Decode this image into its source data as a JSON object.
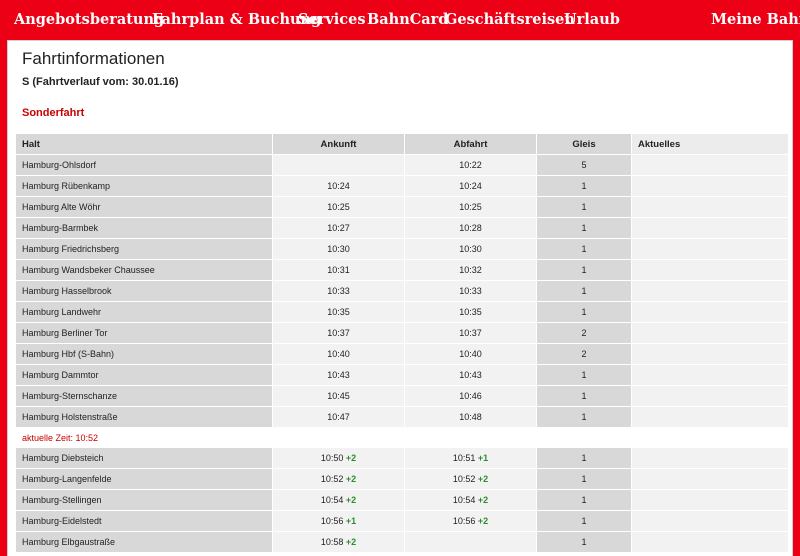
{
  "nav": {
    "items": [
      "Angebotsberatung",
      "Fahrplan & Buchung",
      "Services",
      "BahnCard",
      "Geschäftsreisen",
      "Urlaub"
    ],
    "meine_bahn": "Meine Bahn"
  },
  "page": {
    "title": "Fahrtinformationen",
    "subtitle": "S (Fahrtverlauf vom: 30.01.16)",
    "special": "Sonderfahrt"
  },
  "table": {
    "headers": {
      "halt": "Halt",
      "ankunft": "Ankunft",
      "abfahrt": "Abfahrt",
      "gleis": "Gleis",
      "aktuelles": "Aktuelles"
    },
    "rows_before": [
      {
        "halt": "Hamburg-Ohlsdorf",
        "ankunft": "",
        "abfahrt": "10:22",
        "gleis": "5"
      },
      {
        "halt": "Hamburg Rübenkamp",
        "ankunft": "10:24",
        "abfahrt": "10:24",
        "gleis": "1"
      },
      {
        "halt": "Hamburg Alte Wöhr",
        "ankunft": "10:25",
        "abfahrt": "10:25",
        "gleis": "1"
      },
      {
        "halt": "Hamburg-Barmbek",
        "ankunft": "10:27",
        "abfahrt": "10:28",
        "gleis": "1"
      },
      {
        "halt": "Hamburg Friedrichsberg",
        "ankunft": "10:30",
        "abfahrt": "10:30",
        "gleis": "1"
      },
      {
        "halt": "Hamburg Wandsbeker Chaussee",
        "ankunft": "10:31",
        "abfahrt": "10:32",
        "gleis": "1"
      },
      {
        "halt": "Hamburg Hasselbrook",
        "ankunft": "10:33",
        "abfahrt": "10:33",
        "gleis": "1"
      },
      {
        "halt": "Hamburg Landwehr",
        "ankunft": "10:35",
        "abfahrt": "10:35",
        "gleis": "1"
      },
      {
        "halt": "Hamburg Berliner Tor",
        "ankunft": "10:37",
        "abfahrt": "10:37",
        "gleis": "2"
      },
      {
        "halt": "Hamburg Hbf (S-Bahn)",
        "ankunft": "10:40",
        "abfahrt": "10:40",
        "gleis": "2"
      },
      {
        "halt": "Hamburg Dammtor",
        "ankunft": "10:43",
        "abfahrt": "10:43",
        "gleis": "1"
      },
      {
        "halt": "Hamburg-Sternschanze",
        "ankunft": "10:45",
        "abfahrt": "10:46",
        "gleis": "1"
      },
      {
        "halt": "Hamburg Holstenstraße",
        "ankunft": "10:47",
        "abfahrt": "10:48",
        "gleis": "1"
      }
    ],
    "current_time": "aktuelle Zeit: 10:52",
    "rows_after": [
      {
        "halt": "Hamburg Diebsteich",
        "ankunft": "10:50",
        "ankunft_delay": "+2",
        "abfahrt": "10:51",
        "abfahrt_delay": "+1",
        "gleis": "1"
      },
      {
        "halt": "Hamburg-Langenfelde",
        "ankunft": "10:52",
        "ankunft_delay": "+2",
        "abfahrt": "10:52",
        "abfahrt_delay": "+2",
        "gleis": "1"
      },
      {
        "halt": "Hamburg-Stellingen",
        "ankunft": "10:54",
        "ankunft_delay": "+2",
        "abfahrt": "10:54",
        "abfahrt_delay": "+2",
        "gleis": "1"
      },
      {
        "halt": "Hamburg-Eidelstedt",
        "ankunft": "10:56",
        "ankunft_delay": "+1",
        "abfahrt": "10:56",
        "abfahrt_delay": "+2",
        "gleis": "1"
      },
      {
        "halt": "Hamburg Elbgaustraße",
        "ankunft": "10:58",
        "ankunft_delay": "+2",
        "abfahrt": "",
        "abfahrt_delay": "",
        "gleis": "1"
      }
    ]
  },
  "colors": {
    "brand_red": "#ec0016",
    "delay_green": "#2e8b2e",
    "alert_red": "#c80000"
  }
}
